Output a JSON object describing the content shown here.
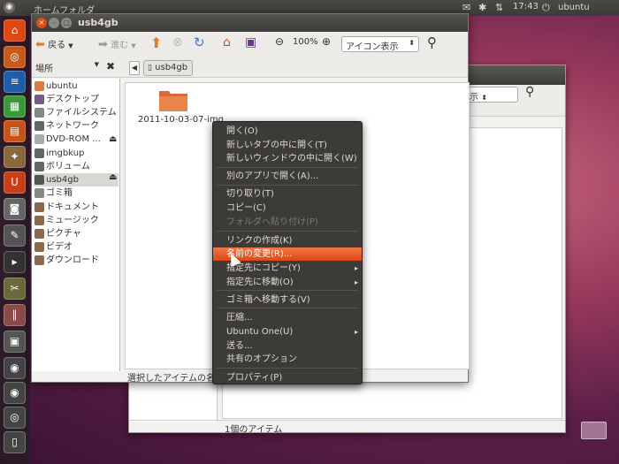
{
  "panel": {
    "title": "ホームフォルダ",
    "time": "17:43",
    "user": "ubuntu"
  },
  "backwin": {
    "view_mode": "表示",
    "status": "1個のアイテム"
  },
  "window": {
    "title": "usb4gb"
  },
  "toolbar": {
    "back_label": "戻る",
    "forward_label": "進む",
    "zoom_label": "100%",
    "view_mode": "アイコン表示"
  },
  "sidebar": {
    "header": "場所",
    "items": [
      {
        "label": "ubuntu",
        "color": "#e07a3a"
      },
      {
        "label": "デスクトップ",
        "color": "#7a5a8a"
      },
      {
        "label": "ファイルシステム",
        "color": "#888"
      },
      {
        "label": "ネットワーク",
        "color": "#666"
      },
      {
        "label": "DVD-ROM ...",
        "color": "#aaa"
      },
      {
        "label": "imgbkup",
        "color": "#666"
      },
      {
        "label": "ボリューム",
        "color": "#666"
      },
      {
        "label": "usb4gb",
        "color": "#555"
      },
      {
        "label": "ゴミ箱",
        "color": "#888"
      },
      {
        "label": "ドキュメント",
        "color": "#8a6a4a"
      },
      {
        "label": "ミュージック",
        "color": "#8a6a4a"
      },
      {
        "label": "ピクチャ",
        "color": "#8a6a4a"
      },
      {
        "label": "ビデオ",
        "color": "#8a6a4a"
      },
      {
        "label": "ダウンロード",
        "color": "#8a6a4a"
      }
    ]
  },
  "location": {
    "crumb": "usb4gb"
  },
  "main": {
    "folder_name": "2011-10-03-07-img",
    "status": "選択したアイテムの名"
  },
  "context_menu": {
    "items": [
      {
        "label": "開く(O)",
        "state": "normal"
      },
      {
        "label": "新しいタブの中に開く(T)",
        "state": "normal"
      },
      {
        "label": "新しいウィンドウの中に開く(W)",
        "state": "normal"
      },
      {
        "label": "別のアプリで開く(A)...",
        "state": "normal"
      },
      {
        "label": "切り取り(T)",
        "state": "normal"
      },
      {
        "label": "コピー(C)",
        "state": "normal"
      },
      {
        "label": "フォルダへ貼り付け(P)",
        "state": "disabled"
      },
      {
        "label": "リンクの作成(K)",
        "state": "normal"
      },
      {
        "label": "名前の変更(R)...",
        "state": "highlighted"
      },
      {
        "label": "指定先にコピー(Y)",
        "state": "submenu"
      },
      {
        "label": "指定先に移動(O)",
        "state": "submenu"
      },
      {
        "label": "ゴミ箱へ移動する(V)",
        "state": "normal"
      },
      {
        "label": "圧縮...",
        "state": "normal"
      },
      {
        "label": "Ubuntu One(U)",
        "state": "submenu"
      },
      {
        "label": "送る...",
        "state": "normal"
      },
      {
        "label": "共有のオプション",
        "state": "normal"
      },
      {
        "label": "プロパティ(P)",
        "state": "normal"
      }
    ]
  },
  "colors": {
    "accent": "#dd4814",
    "menu_bg": "#3c3b37",
    "panel_bg": "#3c3b37"
  }
}
